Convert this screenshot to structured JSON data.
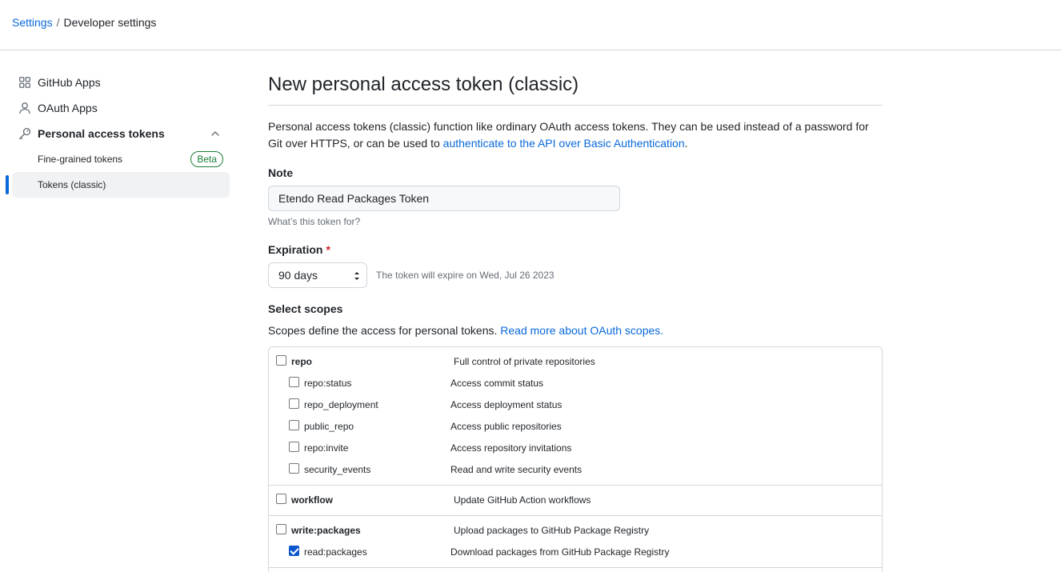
{
  "breadcrumb": {
    "root": "Settings",
    "separator": "/",
    "current": "Developer settings"
  },
  "sidebar": {
    "items": [
      {
        "label": "GitHub Apps",
        "icon": "apps-grid-icon"
      },
      {
        "label": "OAuth Apps",
        "icon": "person-icon"
      },
      {
        "label": "Personal access tokens",
        "icon": "key-icon"
      }
    ],
    "subitems": [
      {
        "label": "Fine-grained tokens",
        "badge": "Beta"
      },
      {
        "label": "Tokens (classic)"
      }
    ]
  },
  "main": {
    "title": "New personal access token (classic)",
    "intro_text": "Personal access tokens (classic) function like ordinary OAuth access tokens. They can be used instead of a password for Git over HTTPS, or can be used to ",
    "intro_link": "authenticate to the API over Basic Authentication",
    "intro_end": ".",
    "note_label": "Note",
    "note_value": "Etendo Read Packages Token",
    "note_hint": "What’s this token for?",
    "expiration_label": "Expiration",
    "required_mark": "*",
    "expiration_value": "90 days",
    "expiration_note": "The token will expire on Wed, Jul 26 2023",
    "scopes_label": "Select scopes",
    "scopes_desc": "Scopes define the access for personal tokens. ",
    "scopes_link": "Read more about OAuth scopes."
  },
  "scopes": {
    "repo": {
      "name": "repo",
      "desc": "Full control of private repositories",
      "checked": false
    },
    "repo_status": {
      "name": "repo:status",
      "desc": "Access commit status",
      "checked": false
    },
    "repo_deployment": {
      "name": "repo_deployment",
      "desc": "Access deployment status",
      "checked": false
    },
    "public_repo": {
      "name": "public_repo",
      "desc": "Access public repositories",
      "checked": false
    },
    "repo_invite": {
      "name": "repo:invite",
      "desc": "Access repository invitations",
      "checked": false
    },
    "security_events": {
      "name": "security_events",
      "desc": "Read and write security events",
      "checked": false
    },
    "workflow": {
      "name": "workflow",
      "desc": "Update GitHub Action workflows",
      "checked": false
    },
    "write_packages": {
      "name": "write:packages",
      "desc": "Upload packages to GitHub Package Registry",
      "checked": false
    },
    "read_packages": {
      "name": "read:packages",
      "desc": "Download packages from GitHub Package Registry",
      "checked": true
    }
  },
  "colors": {
    "accent": "#0969da",
    "success": "#1a7f37",
    "danger": "#cf222e"
  }
}
